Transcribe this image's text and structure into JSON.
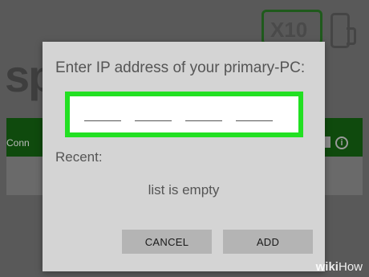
{
  "background": {
    "logo_text": "sp",
    "x10_label": "X10",
    "connection_label": "Conn"
  },
  "dialog": {
    "title": "Enter IP address of your primary-PC:",
    "ip_segments": [
      "",
      "",
      "",
      ""
    ],
    "recent_label": "Recent:",
    "empty_text": "list is empty",
    "cancel_label": "CANCEL",
    "add_label": "ADD"
  },
  "watermark": {
    "wiki": "wiki",
    "how": "How"
  },
  "colors": {
    "highlight": "#22e022",
    "dialog_bg": "#d4d4d4",
    "button_bg": "#b4b4b4",
    "bar_green": "#0f4a0d"
  }
}
